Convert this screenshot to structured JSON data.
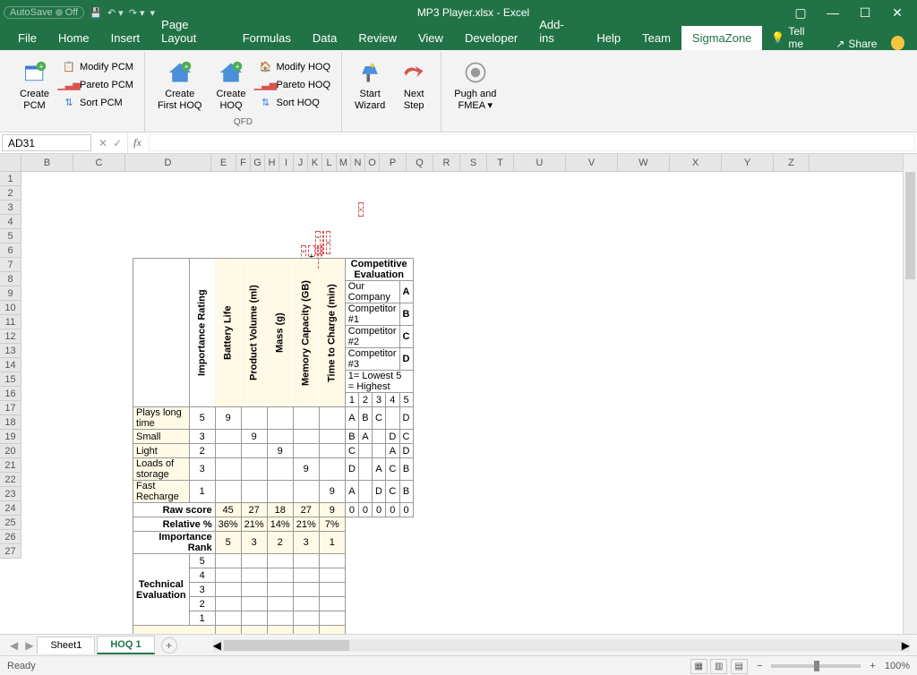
{
  "titlebar": {
    "autosave_label": "AutoSave",
    "autosave_state": "Off",
    "title": "MP3 Player.xlsx - Excel"
  },
  "tabs": [
    "File",
    "Home",
    "Insert",
    "Page Layout",
    "Formulas",
    "Data",
    "Review",
    "View",
    "Developer",
    "Add-ins",
    "Help",
    "Team",
    "SigmaZone"
  ],
  "tellme": "Tell me",
  "share": "Share",
  "ribbon": {
    "create_pcm": "Create\nPCM",
    "modify_pcm": "Modify PCM",
    "pareto_pcm": "Pareto PCM",
    "sort_pcm": "Sort PCM",
    "create_first_hoq": "Create\nFirst HOQ",
    "create_hoq": "Create\nHOQ",
    "modify_hoq": "Modify HOQ",
    "pareto_hoq": "Pareto HOQ",
    "sort_hoq": "Sort HOQ",
    "qfd_label": "QFD",
    "start_wizard": "Start\nWizard",
    "next_step": "Next\nStep",
    "pugh_fmea": "Pugh and\nFMEA"
  },
  "namebox": "AD31",
  "columns": [
    "B",
    "C",
    "D",
    "E",
    "F",
    "G",
    "H",
    "I",
    "J",
    "K",
    "L",
    "M",
    "N",
    "O",
    "P",
    "Q",
    "R",
    "S",
    "T",
    "U",
    "V",
    "W",
    "X",
    "Y",
    "Z"
  ],
  "rows_start": 1,
  "rows_end": 27,
  "hoq": {
    "roof": {
      "r3": [
        "-"
      ],
      "r5": [
        "--",
        "-"
      ],
      "r6": [
        "--",
        "+",
        "",
        ""
      ]
    },
    "importance_label": "Importance Rating",
    "tech_chars": [
      "Battery Life",
      "Product Volume (ml)",
      "Mass (g)",
      "Memory Capacity (GB)",
      "Time to Charge (min)"
    ],
    "comp_eval_title": "Competitive Evaluation",
    "companies": [
      {
        "name": "Our Company",
        "code": "A"
      },
      {
        "name": "Competitor #1",
        "code": "B"
      },
      {
        "name": "Competitor #2",
        "code": "C"
      },
      {
        "name": "Competitor #3",
        "code": "D"
      }
    ],
    "scale_label": "1= Lowest     5 = Highest",
    "scale": [
      "1",
      "2",
      "3",
      "4",
      "5"
    ],
    "customer_reqs": [
      {
        "name": "Plays long time",
        "imp": 5,
        "rel": [
          9,
          "",
          "",
          "",
          ""
        ],
        "comp": [
          "A",
          "B",
          "C",
          "",
          "D"
        ]
      },
      {
        "name": "Small",
        "imp": 3,
        "rel": [
          "",
          9,
          "",
          "",
          ""
        ],
        "comp": [
          "B",
          "A",
          "",
          "D",
          "C"
        ]
      },
      {
        "name": "Light",
        "imp": 2,
        "rel": [
          "",
          "",
          9,
          "",
          ""
        ],
        "comp": [
          "C",
          "",
          "",
          "A",
          "D"
        ]
      },
      {
        "name": "Loads of storage",
        "imp": 3,
        "rel": [
          "",
          "",
          "",
          9,
          ""
        ],
        "comp": [
          "D",
          "",
          "A",
          "C",
          "B"
        ]
      },
      {
        "name": "Fast Recharge",
        "imp": 1,
        "rel": [
          "",
          "",
          "",
          "",
          9
        ],
        "comp": [
          "A",
          "",
          "D",
          "C",
          "B"
        ]
      }
    ],
    "raw_score_label": "Raw score",
    "raw_score": [
      45,
      27,
      18,
      27,
      9
    ],
    "relative_label": "Relative %",
    "relative": [
      "36%",
      "21%",
      "14%",
      "21%",
      "7%"
    ],
    "rank_label": "Importance Rank",
    "rank": [
      5,
      3,
      2,
      3,
      1
    ],
    "zeros": [
      "0",
      "0",
      "0",
      "0",
      "0"
    ],
    "tech_eval_label": "Technical Evaluation",
    "tech_eval_scale": [
      5,
      4,
      3,
      2,
      1
    ]
  },
  "sheets": [
    "Sheet1",
    "HOQ 1"
  ],
  "status": {
    "ready": "Ready",
    "zoom": "100%"
  }
}
